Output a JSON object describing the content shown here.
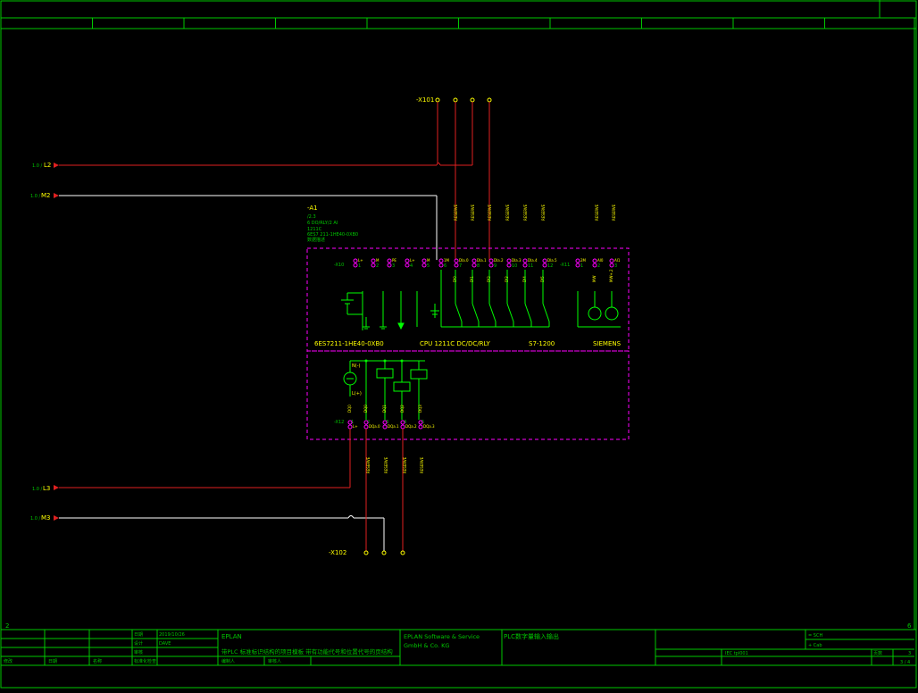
{
  "colors": {
    "background": "#000000",
    "frame": "#00c800",
    "wire_live": "#e02020",
    "wire_neutral": "#ffffff",
    "plc_border": "#ff00ff",
    "text_yellow": "#ffff00",
    "text_green": "#00ff00"
  },
  "border": {
    "columns": [
      "",
      "",
      "",
      "",
      "",
      "",
      "",
      "",
      "",
      ""
    ],
    "corner_left": "2",
    "corner_right": "6"
  },
  "wires": {
    "l2": {
      "ref": "1.0 /",
      "name": "L2"
    },
    "m2": {
      "ref": "1.0 /",
      "name": "M2"
    },
    "l3": {
      "ref": "1.0 /",
      "name": "L3"
    },
    "m3": {
      "ref": "1.0 /",
      "name": "M3"
    }
  },
  "terminal_strips": {
    "x101": "-X101",
    "x102": "-X102",
    "x10": "-X10",
    "x11": "-X11",
    "x12": "-X12"
  },
  "plc": {
    "tag": "-A1",
    "info": [
      "/2.3",
      "6 DO/RLY/2 AI",
      "1211C",
      "6ES7 211-1HE40-0XB0",
      "数据描述"
    ],
    "order_number": "6ES7211-1HE40-0XB0",
    "cpu_name": "CPU 1211C DC/DC/RLY",
    "family": "S7-1200",
    "vendor": "SIEMENS",
    "reserve": "RESERVE",
    "top_labels": [
      "L+",
      "M",
      "PE",
      "L+",
      "M",
      "1M",
      "DIa.0",
      "DIa.1",
      "DIa.2",
      "DIa.3",
      "DIa.4",
      "DIa.5"
    ],
    "top_numbers": [
      "1",
      "2",
      "3",
      "4",
      "5",
      "6",
      "7",
      "8",
      "9",
      "10",
      "11",
      "12"
    ],
    "ai_labels": [
      "2M",
      "AI0",
      "AI1"
    ],
    "ai_numbers": [
      "1",
      "2",
      "3"
    ],
    "vertical_labels": [
      "DC24",
      "DC24",
      "DI0",
      "DI1",
      "DI2",
      "DI3",
      "DI4",
      "DI5"
    ],
    "ai_vertical": [
      "MW",
      "MW+.2"
    ],
    "out_labels": [
      "L+",
      "DQa.0",
      "DQa.1",
      "DQa.2",
      "DQa.3"
    ],
    "out_numbers": [
      "1",
      "2",
      "3",
      "4",
      "5"
    ],
    "out_vertical": [
      "DQ0",
      "DQ0",
      "DQ1",
      "DQ2",
      "DQ3"
    ],
    "supply_plus": "N(-)",
    "supply_minus": "L(+)"
  },
  "title_block": {
    "labels": [
      "日期",
      "设计",
      "审核",
      "",
      "",
      "",
      "",
      "",
      "标准化",
      "批准",
      "",
      "",
      "原始设计"
    ],
    "date_label": "日期",
    "date_value": "2019/10/26",
    "designer_label": "设计",
    "designer_value": "DAVE",
    "check_label": "审核",
    "std_label": "标准化检查",
    "company": "EPLAN",
    "description": "带PLC 标准标识结构的项目模板 带有功能代号和位置代号的页结构",
    "company2": "EPLAN Software & Service GmbH & Co. KG",
    "page_title": "PLC数字量输入输出",
    "field_a": "= SCH",
    "field_b": "+ Cab",
    "standard": "IEC tpl001",
    "page_label": "页数",
    "page_value": "3",
    "page_count": "3 / 4",
    "revision_labels": [
      "修改",
      "日期",
      "名称"
    ],
    "engineer_label": "编制人",
    "approver_label": "审核人"
  }
}
